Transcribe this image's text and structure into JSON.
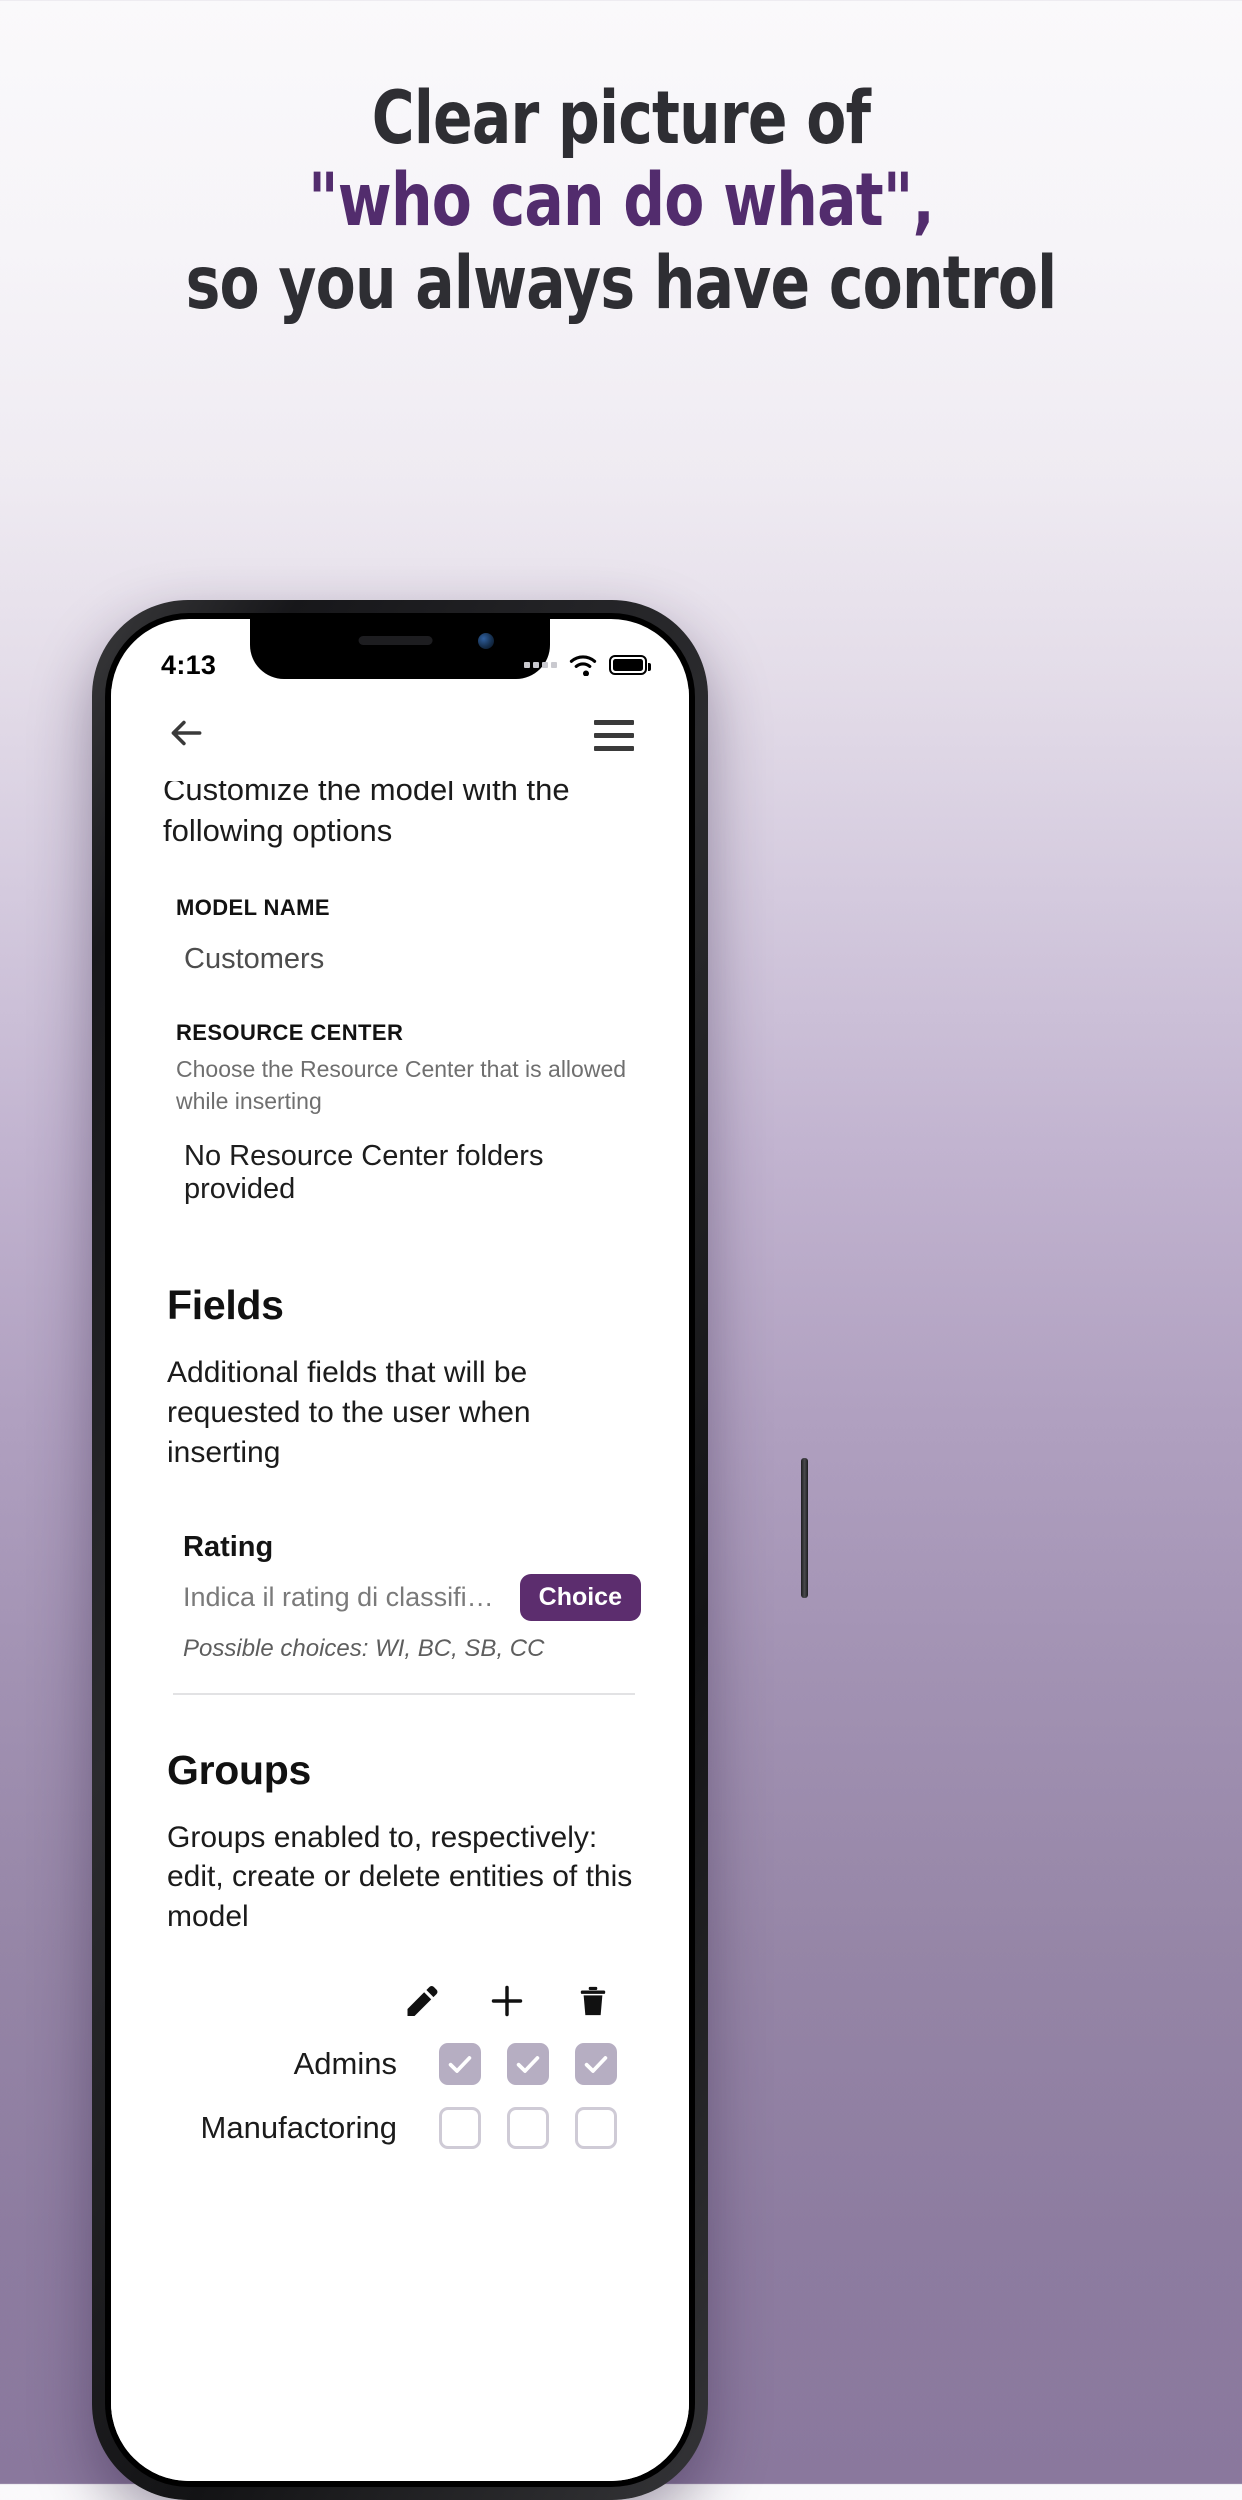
{
  "headline": {
    "line1": "Clear picture of",
    "line2": "\"who can do what\",",
    "line3": "so you always have control",
    "accent_color": "#522c6d",
    "text_color": "#2e2e33"
  },
  "phone": {
    "status_bar": {
      "time": "4:13",
      "signal_icon": "signal-dots-icon",
      "wifi_icon": "wifi-icon",
      "battery_icon": "battery-full-icon"
    },
    "app_bar": {
      "back_icon": "arrow-left-icon",
      "menu_icon": "hamburger-menu-icon"
    },
    "screen": {
      "intro_text": "Customize the model with the following options",
      "model_name": {
        "label": "MODEL NAME",
        "value": "Customers"
      },
      "resource_center": {
        "label": "RESOURCE CENTER",
        "description": "Choose the Resource Center that is allowed while inserting",
        "value": "No Resource Center folders provided"
      },
      "fields": {
        "heading": "Fields",
        "description": "Additional fields that will be requested to the user when inserting",
        "items": [
          {
            "name": "Rating",
            "description": "Indica il rating di classificazione…",
            "badge": "Choice",
            "badge_color": "#5c2d6e",
            "choices": "Possible choices: WI, BC, SB, CC"
          }
        ]
      },
      "groups": {
        "heading": "Groups",
        "description": "Groups enabled to, respectively: edit, create or delete entities of this model",
        "permission_icons": [
          "pencil-edit-icon",
          "plus-add-icon",
          "trash-delete-icon"
        ],
        "rows": [
          {
            "name": "Admins",
            "edit": true,
            "create": true,
            "delete": true
          },
          {
            "name": "Manufactoring",
            "edit": false,
            "create": false,
            "delete": false
          }
        ]
      }
    }
  }
}
